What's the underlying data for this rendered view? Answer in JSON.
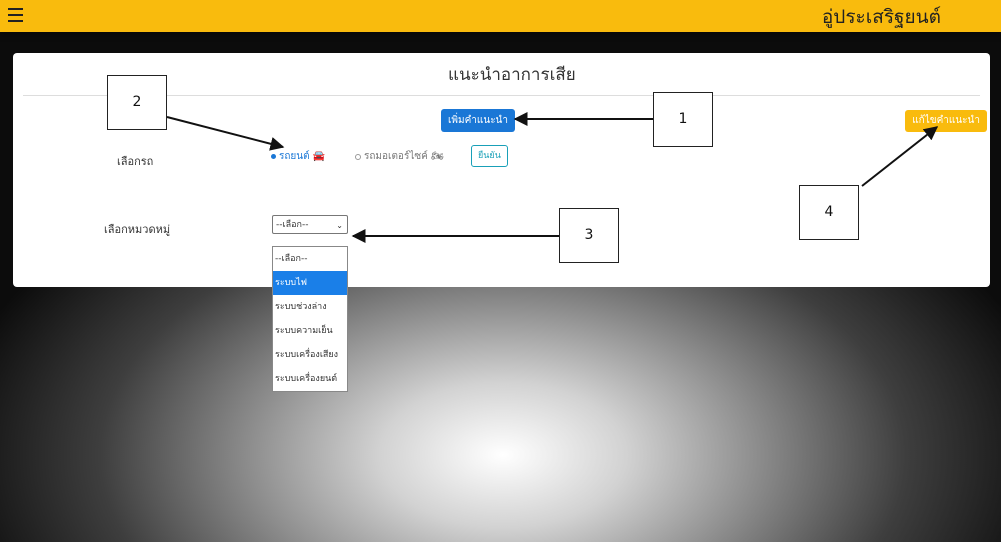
{
  "topbar": {
    "brand": "อู่ประเสริฐยนต์",
    "menu_icon": "hamburger-menu-icon",
    "bg_color": "#f9bb0d"
  },
  "panel": {
    "title": "แนะนำอาการเสีย",
    "add_button": "เพิ่มคำแนะนำ",
    "edit_button": "แก้ไขคำแนะนำ",
    "vehicle_label": "เลือกรถ",
    "vehicle_options": [
      {
        "label": "รถยนต์ 🚘",
        "checked": true
      },
      {
        "label": "รถมอเตอร์ไซค์ 🏍",
        "checked": false
      }
    ],
    "confirm_button": "ยืนยัน",
    "category_label": "เลือกหมวดหมู่",
    "category_select": {
      "value": "--เลือก--",
      "chevron": "⌄"
    },
    "category_options": [
      "--เลือก--",
      "ระบบไฟ",
      "ระบบช่วงล่าง",
      "ระบบความเย็น",
      "ระบบเครื่องเสียง",
      "ระบบเครื่องยนต์"
    ],
    "highlighted_option": "ระบบไฟ"
  },
  "callouts": [
    "1",
    "2",
    "3",
    "4"
  ],
  "colors": {
    "primary": "#1a77d6",
    "warning": "#f9bb0d",
    "info": "#19a0b8"
  }
}
